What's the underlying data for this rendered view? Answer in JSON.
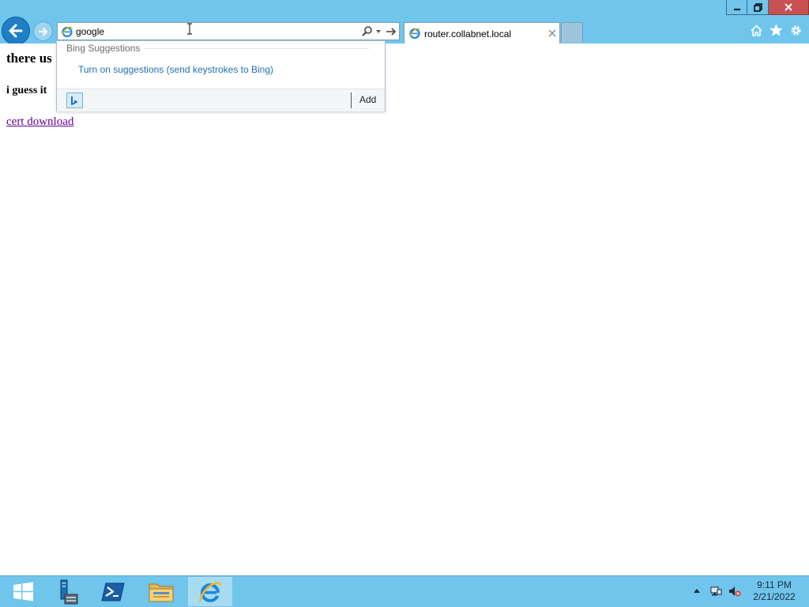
{
  "browser": {
    "address_value": "google",
    "tab_title": "router.collabnet.local"
  },
  "page": {
    "heading_one": "there us",
    "heading_two": "i guess it",
    "download_link": "cert download"
  },
  "suggestions": {
    "header": "Bing Suggestions",
    "turn_on_label": "Turn on suggestions (send keystrokes to Bing)",
    "add_label": "Add"
  },
  "taskbar": {
    "time": "9:11 PM",
    "date": "2/21/2022"
  },
  "colors": {
    "chrome": "#6fc5ec",
    "close": "#c75050",
    "link": "#660099",
    "suggest_link": "#1e6fb5"
  },
  "icons": [
    "minimize-icon",
    "restore-icon",
    "close-icon",
    "back-arrow-icon",
    "forward-arrow-icon",
    "ie-icon",
    "search-icon",
    "go-arrow-icon",
    "home-icon",
    "star-icon",
    "gear-icon",
    "windows-start-icon",
    "server-manager-icon",
    "powershell-icon",
    "file-explorer-icon",
    "internet-explorer-icon",
    "network-icon",
    "volume-muted-icon",
    "bing-icon"
  ]
}
